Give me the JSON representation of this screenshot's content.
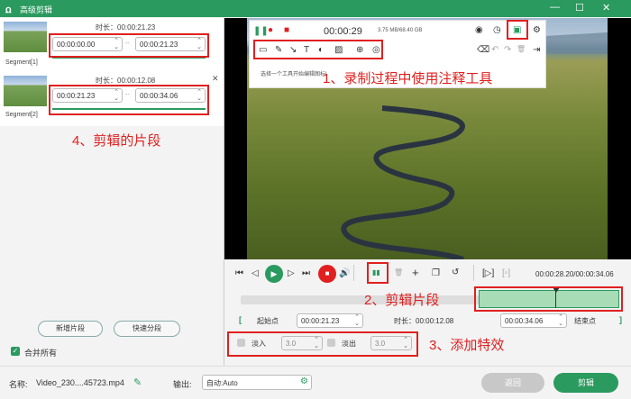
{
  "window": {
    "title": "高级剪辑",
    "minimize_glyph": "—",
    "maximize_glyph": "☐",
    "close_glyph": "✕",
    "logo_glyph": "ꭥ"
  },
  "segments": [
    {
      "label": "Segment[1]",
      "duration": "时长：00:00:21.23",
      "start": "00:00:00.00",
      "end": "00:00:21.23",
      "sep": "--"
    },
    {
      "label": "Segment[2]",
      "duration": "时长：00:00:12.08",
      "start": "00:00:21.23",
      "end": "00:00:34.06",
      "sep": "--"
    }
  ],
  "spin_glyphs": {
    "up": "⌃",
    "down": "⌄"
  },
  "segment_close_glyph": "✕",
  "left_buttons": {
    "new_segment": "新增片段",
    "quick_split": "快速分段"
  },
  "merge_all": {
    "label": "合并所有",
    "checked": true
  },
  "annotations": {
    "a1": "1、录制过程中使用注释工具",
    "a2": "2、剪辑片段",
    "a3": "3、添加特效",
    "a4": "4、剪辑的片段"
  },
  "recorder": {
    "time": "00:00:29",
    "size": "3.75 MB/68.40 GB",
    "hint": "选择一个工具开始编辑图标!"
  },
  "recorder_icons": {
    "pause": "❚❚",
    "record": "●",
    "stop": "■",
    "camera": "◉",
    "clock": "◷",
    "toolbox": "▣",
    "settings": "⚙",
    "rect": "▭",
    "pen": "✎",
    "arrow": "↘",
    "text": "T",
    "blur": "◐",
    "image": "▨",
    "zoom": "⊕",
    "spot": "◎",
    "eraser": "⌫",
    "undo": "↶",
    "redo": "↷",
    "trash": "🗑",
    "exit": "⇥"
  },
  "playback": {
    "time": "00:00:28.20/00:00:34.06"
  },
  "playback_icons": {
    "prev": "⏮",
    "back": "◁",
    "play": "▶",
    "fwd": "▷",
    "next": "⏭",
    "stop": "■",
    "volume": "🔊",
    "split": "▮▮",
    "delete": "🗑",
    "add": "+",
    "copy": "❐",
    "reset": "↺",
    "mark_in": "[▷]",
    "mark_out": "[▫]"
  },
  "trim": {
    "start_label": "起始点",
    "start": "00:00:21.23",
    "duration_label": "时长：00:00:12.08",
    "end": "00:00:34.06",
    "end_label": "结束点",
    "bracket_l": "[",
    "bracket_r": "]"
  },
  "fade": {
    "in_label": "淡入",
    "in_value": "3.0",
    "out_label": "淡出",
    "out_value": "3.0"
  },
  "bottom": {
    "name_label": "名称:",
    "name_value": "Video_230....45723.mp4",
    "edit_icon": "✎",
    "output_label": "输出:",
    "output_value": "自动:Auto",
    "gear_icon": "⚙",
    "back_button": "返回",
    "cut_button": "剪辑"
  },
  "colors": {
    "accent": "#2a9a5f",
    "annotation_red": "#e02020"
  }
}
